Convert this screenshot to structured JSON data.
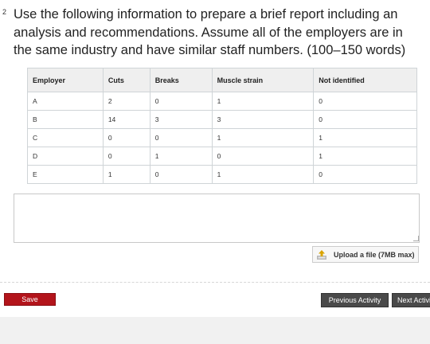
{
  "question": {
    "number": "2",
    "text": "Use the following information to prepare a brief report including an analysis and recommendations. Assume all of the employers are in the same industry and have similar staff numbers. (100–150 words)"
  },
  "table": {
    "headers": [
      "Employer",
      "Cuts",
      "Breaks",
      "Muscle strain",
      "Not identified"
    ],
    "rows": [
      [
        "A",
        "2",
        "0",
        "1",
        "0"
      ],
      [
        "B",
        "14",
        "3",
        "3",
        "0"
      ],
      [
        "C",
        "0",
        "0",
        "1",
        "1"
      ],
      [
        "D",
        "0",
        "1",
        "0",
        "1"
      ],
      [
        "E",
        "1",
        "0",
        "1",
        "0"
      ]
    ]
  },
  "answer": {
    "value": ""
  },
  "upload": {
    "label": "Upload a file (7MB max)",
    "icon": "upload-icon"
  },
  "footer": {
    "save_label": "Save",
    "previous_label": "Previous Activity",
    "next_label": "Next Activity"
  },
  "colors": {
    "save_button": "#b3141b",
    "nav_button": "#4a4a4a",
    "table_header_bg": "#efefef"
  }
}
